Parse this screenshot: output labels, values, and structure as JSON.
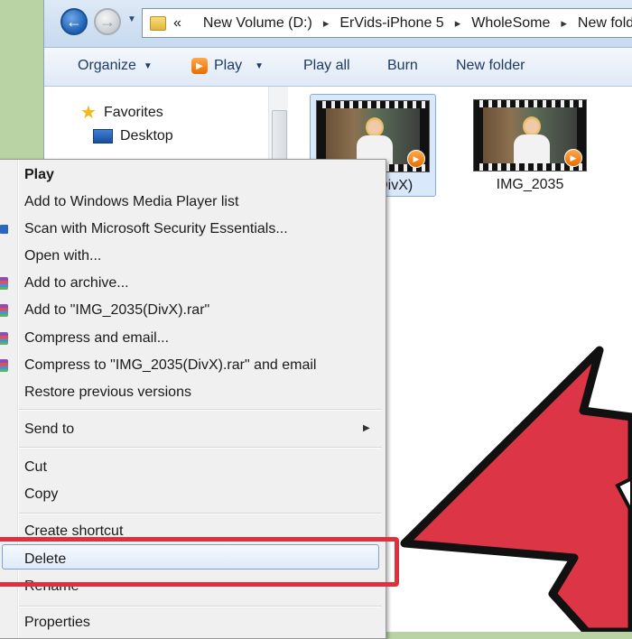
{
  "address_bar": {
    "crumbs": [
      "New Volume (D:)",
      "ErVids-iPhone 5",
      "WholeSome",
      "New fold"
    ],
    "lead": "«"
  },
  "command_bar": {
    "organize": "Organize",
    "play": "Play",
    "play_all": "Play all",
    "burn": "Burn",
    "new_folder": "New folder"
  },
  "nav_pane": {
    "favorites": "Favorites",
    "desktop": "Desktop"
  },
  "files": [
    {
      "label": "(DivX)",
      "selected": true
    },
    {
      "label": "IMG_2035",
      "selected": false
    }
  ],
  "context_menu": {
    "items": [
      "Play",
      "Add to Windows Media Player list",
      "Scan with Microsoft Security Essentials...",
      "Open with...",
      "Add to archive...",
      "Add to \"IMG_2035(DivX).rar\"",
      "Compress and email...",
      "Compress to \"IMG_2035(DivX).rar\" and email",
      "Restore previous versions",
      "Send to",
      "Cut",
      "Copy",
      "Create shortcut",
      "Delete",
      "Rename",
      "Properties"
    ]
  },
  "colors": {
    "highlight": "#e0303e",
    "arrow_fill": "#dc3545",
    "arrow_stroke": "#111111",
    "background": "#b9d3a4"
  },
  "icons": {
    "back": "back-arrow-icon",
    "forward": "forward-arrow-icon",
    "folder": "folder-icon",
    "play": "play-icon",
    "favorites": "star-icon",
    "desktop": "desktop-icon",
    "archive": "winrar-icon",
    "security": "security-essentials-icon"
  }
}
